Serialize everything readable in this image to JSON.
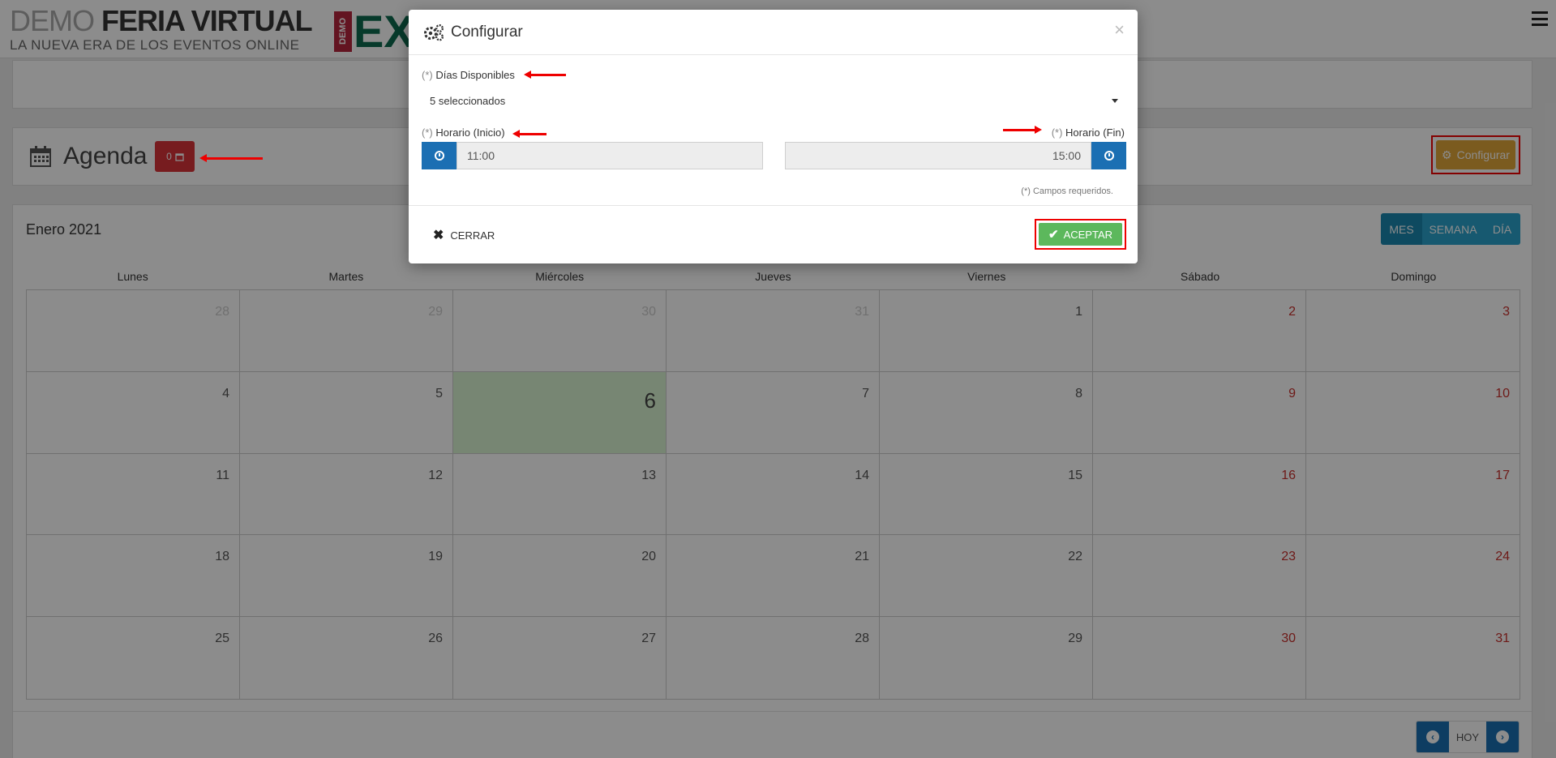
{
  "brand": {
    "light": "DEMO ",
    "bold": "FERIA VIRTUAL",
    "tagline": "LA NUEVA ERA DE LOS EVENTOS ONLINE",
    "logo_tab": "DEMO",
    "logo_text": "EX"
  },
  "agenda": {
    "title": "Agenda",
    "badge_count": "0",
    "configure_label": "Configurar"
  },
  "calendar": {
    "month_label": "Enero 2021",
    "views": [
      "MES",
      "SEMANA",
      "DÍA"
    ],
    "active_view": "MES",
    "weekdays": [
      "Lunes",
      "Martes",
      "Miércoles",
      "Jueves",
      "Viernes",
      "Sábado",
      "Domingo"
    ],
    "weeks": [
      [
        "28",
        "29",
        "30",
        "31",
        "1",
        "2",
        "3"
      ],
      [
        "4",
        "5",
        "6",
        "7",
        "8",
        "9",
        "10"
      ],
      [
        "11",
        "12",
        "13",
        "14",
        "15",
        "16",
        "17"
      ],
      [
        "18",
        "19",
        "20",
        "21",
        "22",
        "23",
        "24"
      ],
      [
        "25",
        "26",
        "27",
        "28",
        "29",
        "30",
        "31"
      ]
    ],
    "today": "6",
    "today_label": "HOY"
  },
  "modal": {
    "title": "Configurar",
    "close": "×",
    "required_mark": "(*)",
    "dias_label": "Días Disponibles",
    "dias_value": "5 seleccionados",
    "inicio_label": "Horario (Inicio)",
    "inicio_value": "11:00",
    "fin_label": "Horario (Fin)",
    "fin_value": "15:00",
    "required_note": "(*) Campos requeridos.",
    "cancel_label": "CERRAR",
    "accept_label": "ACEPTAR"
  },
  "colors": {
    "primary": "#1b6fb3",
    "success": "#5cb85c",
    "danger": "#d9343a",
    "warning": "#e0a63a",
    "info": "#2aa3cc",
    "today_bg": "#d9f4d1"
  }
}
